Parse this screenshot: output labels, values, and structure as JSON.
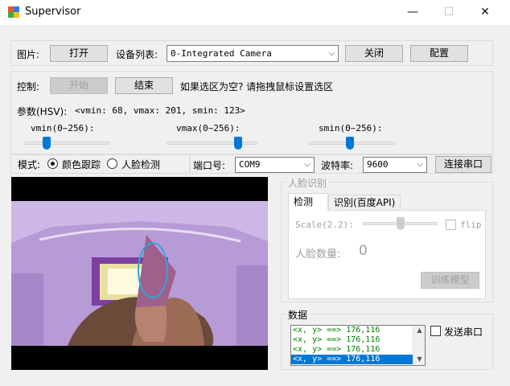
{
  "window": {
    "title": "Supervisor",
    "minimize": "—",
    "maximize": "☐",
    "close": "✕"
  },
  "row_image": {
    "label": "图片:",
    "open_button": "打开",
    "device_list_label": "设备列表:",
    "device_selected": "0-Integrated Camera",
    "close_button": "关闭",
    "config_button": "配置"
  },
  "row_control": {
    "label": "控制:",
    "start_button": "开始",
    "end_button": "结束",
    "hint": "如果选区为空? 请拖拽鼠标设置选区"
  },
  "params": {
    "label": "参数(HSV):",
    "values_text": "<vmin: 68, vmax: 201, smin: 123>",
    "vmin_label": "vmin(0~256):",
    "vmax_label": "vmax(0~256):",
    "smin_label": "smin(0~256):",
    "vmin_value": 68,
    "vmax_value": 201,
    "smin_value": 123,
    "max": 256
  },
  "mode": {
    "label": "模式:",
    "option_color": "颜色跟踪",
    "option_face": "人脸检测",
    "selected": "颜色跟踪"
  },
  "serial": {
    "port_label": "端口号:",
    "port_value": "COM9",
    "baud_label": "波特率:",
    "baud_value": "9600",
    "connect_button": "连接串口"
  },
  "face": {
    "group_label": "人脸识别",
    "tab_detect": "检测",
    "tab_identify": "识别(百度API)",
    "scale_label": "Scale(2.2):",
    "scale_fraction": 0.5,
    "flip_label": "flip",
    "count_label": "人脸数量:",
    "count_value": "0",
    "train_button": "训练模型"
  },
  "data_panel": {
    "group_label": "数据",
    "items": [
      "<x, y> ==> 176,116",
      "<x, y> ==> 176,116",
      "<x, y> ==> 176,116",
      "<x, y> ==> 176,116"
    ],
    "send_label": "发送串口"
  },
  "colors": {
    "accent": "#0078d7",
    "tracking_ellipse": "#29a8e0",
    "tracked_object": "#a0608c"
  }
}
